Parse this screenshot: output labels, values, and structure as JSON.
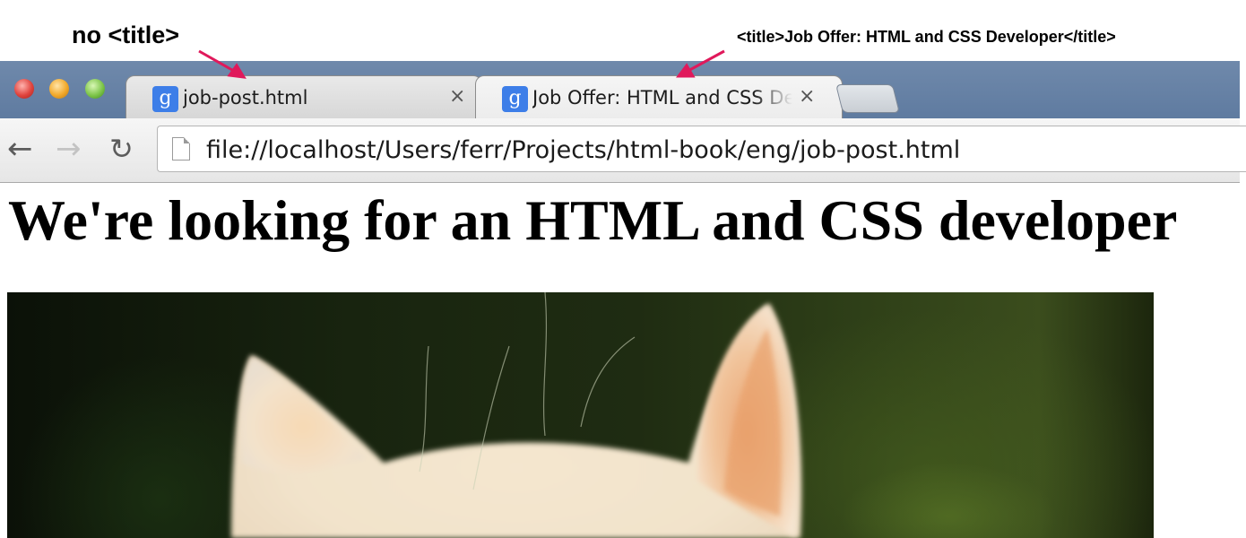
{
  "annotations": {
    "left": "no <title>",
    "right": "<title>Job Offer: HTML and CSS Developer</title>"
  },
  "browser": {
    "window_controls": [
      "close",
      "minimize",
      "maximize"
    ],
    "tabs": [
      {
        "title": "job-post.html",
        "favicon": "g",
        "close": "×",
        "active": false
      },
      {
        "title": "Job Offer: HTML and CSS Developer",
        "favicon": "g",
        "close": "×",
        "active": true
      }
    ],
    "nav": {
      "back": "←",
      "forward": "→",
      "reload": "↻"
    },
    "address_bar": {
      "url": "file://localhost/Users/ferr/Projects/html-book/eng/job-post.html"
    }
  },
  "page": {
    "heading": "We're looking for an HTML and CSS developer",
    "image": "cat-photo"
  },
  "colors": {
    "annotation_arrow": "#e0195b",
    "tabstrip": "#6782a6",
    "favicon": "#3d7ee8"
  }
}
